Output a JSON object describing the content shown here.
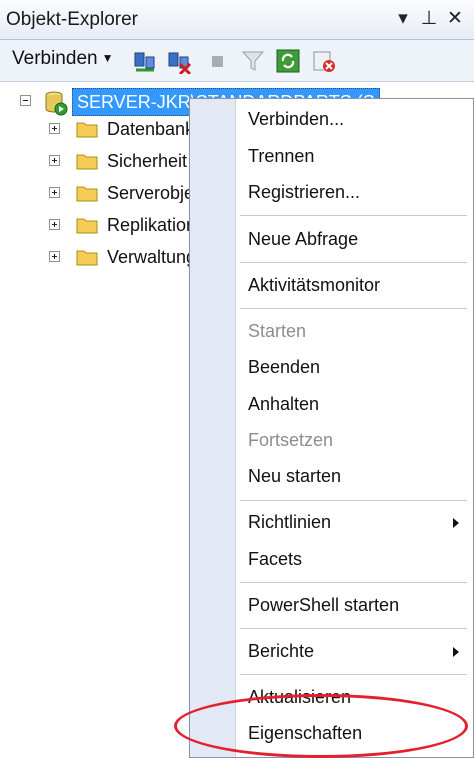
{
  "window": {
    "title": "Objekt-Explorer",
    "controls": {
      "dropdown": "▾",
      "pin": "⊥",
      "close": "✕"
    }
  },
  "toolbar": {
    "connect_label": "Verbinden",
    "icons": [
      "connect-server-icon",
      "disconnect-server-icon",
      "stop-icon",
      "filter-icon",
      "refresh-icon",
      "delete-icon"
    ]
  },
  "tree": {
    "server_label": "SERVER-JKR\\STANDARDPARTS (S",
    "nodes": [
      {
        "label": "Datenbanken"
      },
      {
        "label": "Sicherheit"
      },
      {
        "label": "Serverobjekte"
      },
      {
        "label": "Replikation"
      },
      {
        "label": "Verwaltung"
      }
    ]
  },
  "context_menu": {
    "items": [
      {
        "label": "Verbinden...",
        "enabled": true
      },
      {
        "label": "Trennen",
        "enabled": true
      },
      {
        "label": "Registrieren...",
        "enabled": true
      },
      {
        "label": "Neue Abfrage",
        "enabled": true
      },
      {
        "label": "Aktivitätsmonitor",
        "enabled": true
      },
      {
        "label": "Starten",
        "enabled": false
      },
      {
        "label": "Beenden",
        "enabled": true
      },
      {
        "label": "Anhalten",
        "enabled": true
      },
      {
        "label": "Fortsetzen",
        "enabled": false
      },
      {
        "label": "Neu starten",
        "enabled": true
      },
      {
        "label": "Richtlinien",
        "enabled": true,
        "submenu": true
      },
      {
        "label": "Facets",
        "enabled": true
      },
      {
        "label": "PowerShell starten",
        "enabled": true
      },
      {
        "label": "Berichte",
        "enabled": true,
        "submenu": true
      },
      {
        "label": "Aktualisieren",
        "enabled": true
      },
      {
        "label": "Eigenschaften",
        "enabled": true
      }
    ]
  },
  "annotation": {
    "highlight_color": "#e5202e",
    "highlighted_item": "Eigenschaften"
  },
  "colors": {
    "selection": "#3399ff",
    "menu_gutter": "#e3e9f4",
    "disabled_text": "#8d8d8d"
  }
}
